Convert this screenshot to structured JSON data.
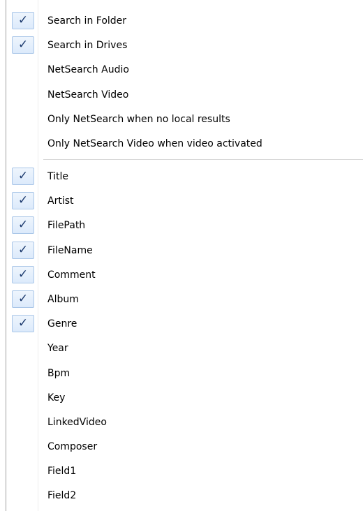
{
  "menu": {
    "check_glyph": "✓",
    "group1": [
      {
        "label": "Search in Folder",
        "checked": true
      },
      {
        "label": "Search in Drives",
        "checked": true
      },
      {
        "label": "NetSearch Audio",
        "checked": false
      },
      {
        "label": "NetSearch Video",
        "checked": false
      },
      {
        "label": "Only NetSearch when no local results",
        "checked": false
      },
      {
        "label": "Only NetSearch Video when video activated",
        "checked": false
      }
    ],
    "group2": [
      {
        "label": "Title",
        "checked": true
      },
      {
        "label": "Artist",
        "checked": true
      },
      {
        "label": "FilePath",
        "checked": true
      },
      {
        "label": "FileName",
        "checked": true
      },
      {
        "label": "Comment",
        "checked": true
      },
      {
        "label": "Album",
        "checked": true
      },
      {
        "label": "Genre",
        "checked": true
      },
      {
        "label": "Year",
        "checked": false
      },
      {
        "label": "Bpm",
        "checked": false
      },
      {
        "label": "Key",
        "checked": false
      },
      {
        "label": "LinkedVideo",
        "checked": false
      },
      {
        "label": "Composer",
        "checked": false
      },
      {
        "label": "Field1",
        "checked": false
      },
      {
        "label": "Field2",
        "checked": false
      }
    ]
  }
}
